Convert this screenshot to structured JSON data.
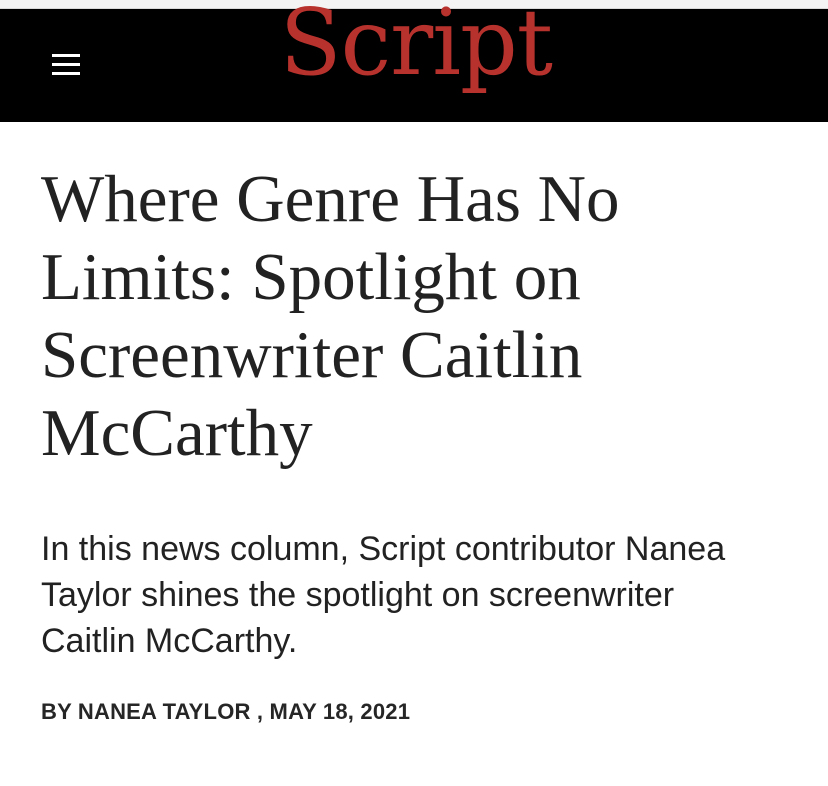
{
  "header": {
    "logo_text": "Script",
    "menu_icon": "hamburger-menu-icon",
    "background_color": "#000000",
    "logo_color": "#b8322d"
  },
  "article": {
    "headline": "Where Genre Has No Limits: Spotlight on Screenwriter Caitlin McCarthy",
    "dek": "In this news column, Script contributor Nanea Taylor shines the spotlight on screenwriter Caitlin McCarthy.",
    "byline": {
      "prefix": "BY",
      "author": "NANEA TAYLOR",
      "separator": ",",
      "date": "MAY 18, 2021"
    }
  }
}
